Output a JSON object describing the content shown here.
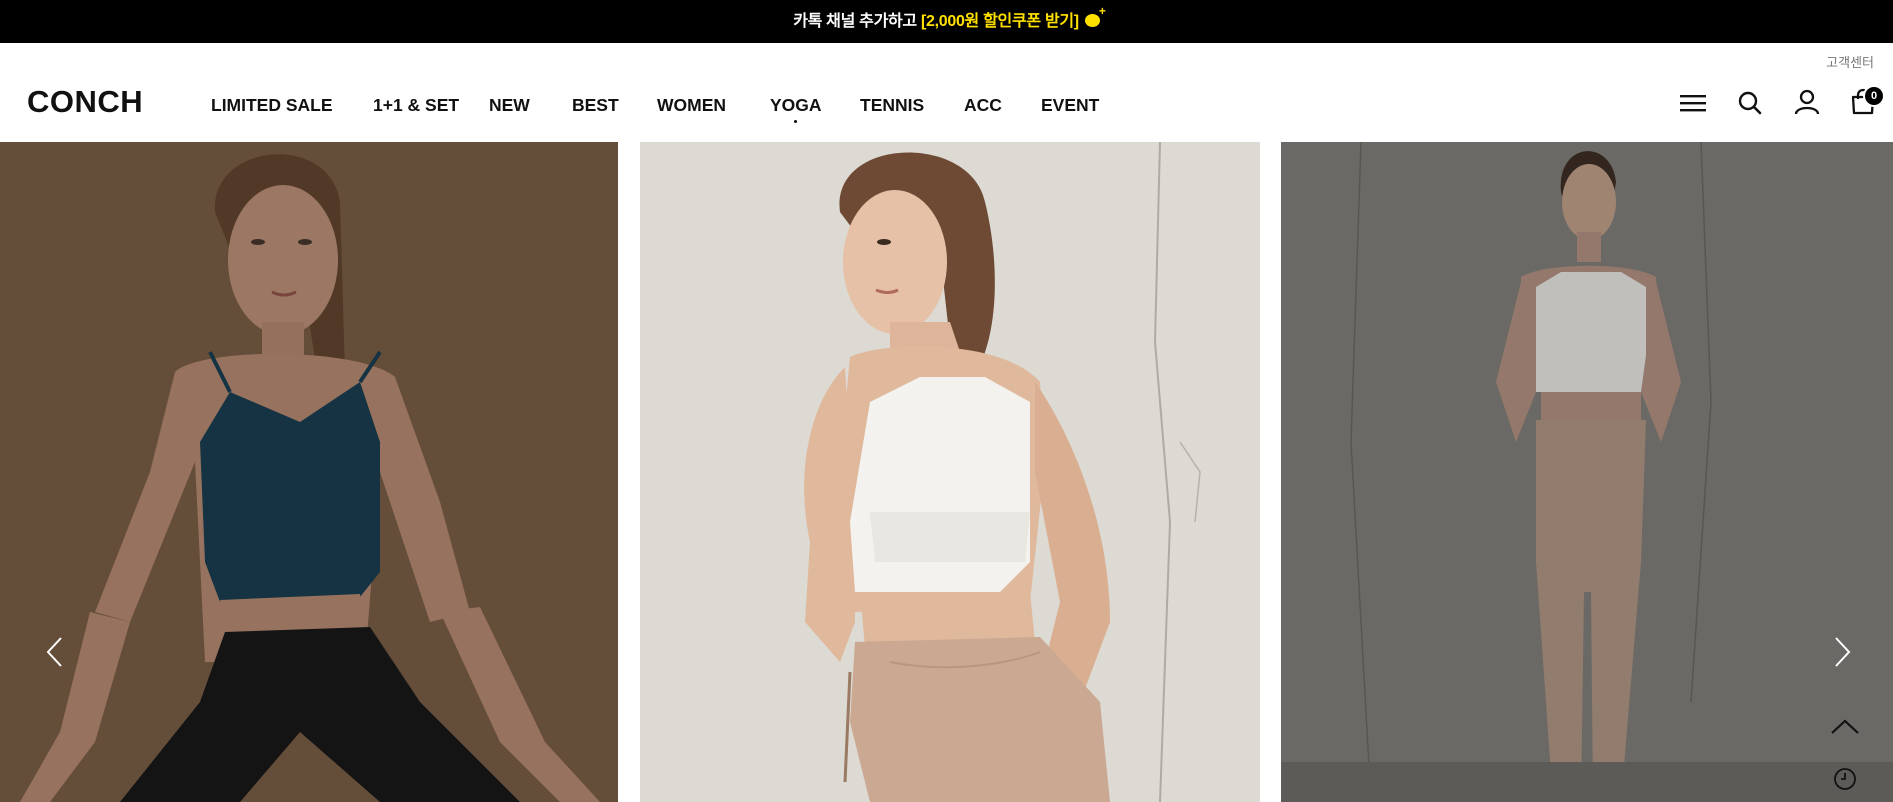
{
  "promo": {
    "text_before": "카톡 채널 추가하고 ",
    "text_highlight": "[2,000원 할인쿠폰 받기]",
    "icon": "kakao-plus-icon"
  },
  "header": {
    "customer_center": "고객센터",
    "logo": "CONCH",
    "nav": [
      {
        "label": "LIMITED SALE"
      },
      {
        "label": "1+1 & SET"
      },
      {
        "label": "NEW"
      },
      {
        "label": "BEST"
      },
      {
        "label": "WOMEN"
      },
      {
        "label": "YOGA"
      },
      {
        "label": "TENNIS"
      },
      {
        "label": "ACC"
      },
      {
        "label": "EVENT"
      }
    ],
    "icons": [
      "menu-icon",
      "search-icon",
      "user-icon",
      "cart-icon"
    ],
    "cart_count": "0"
  },
  "slider": {
    "slides": [
      {
        "name": "model-navy-top-black-leggings",
        "bg": "#8a6a4f"
      },
      {
        "name": "model-white-bra-beige-leggings",
        "bg": "#e2e0d8"
      },
      {
        "name": "model-white-crop-beige-leggings",
        "bg": "#6f6d68"
      }
    ],
    "prev_icon": "chevron-left-icon",
    "next_icon": "chevron-right-icon",
    "side_icons": [
      "scroll-top-icon",
      "recent-view-icon"
    ]
  },
  "colors": {
    "promo_bg": "#000000",
    "promo_highlight": "#ffe100",
    "text": "#111111"
  }
}
